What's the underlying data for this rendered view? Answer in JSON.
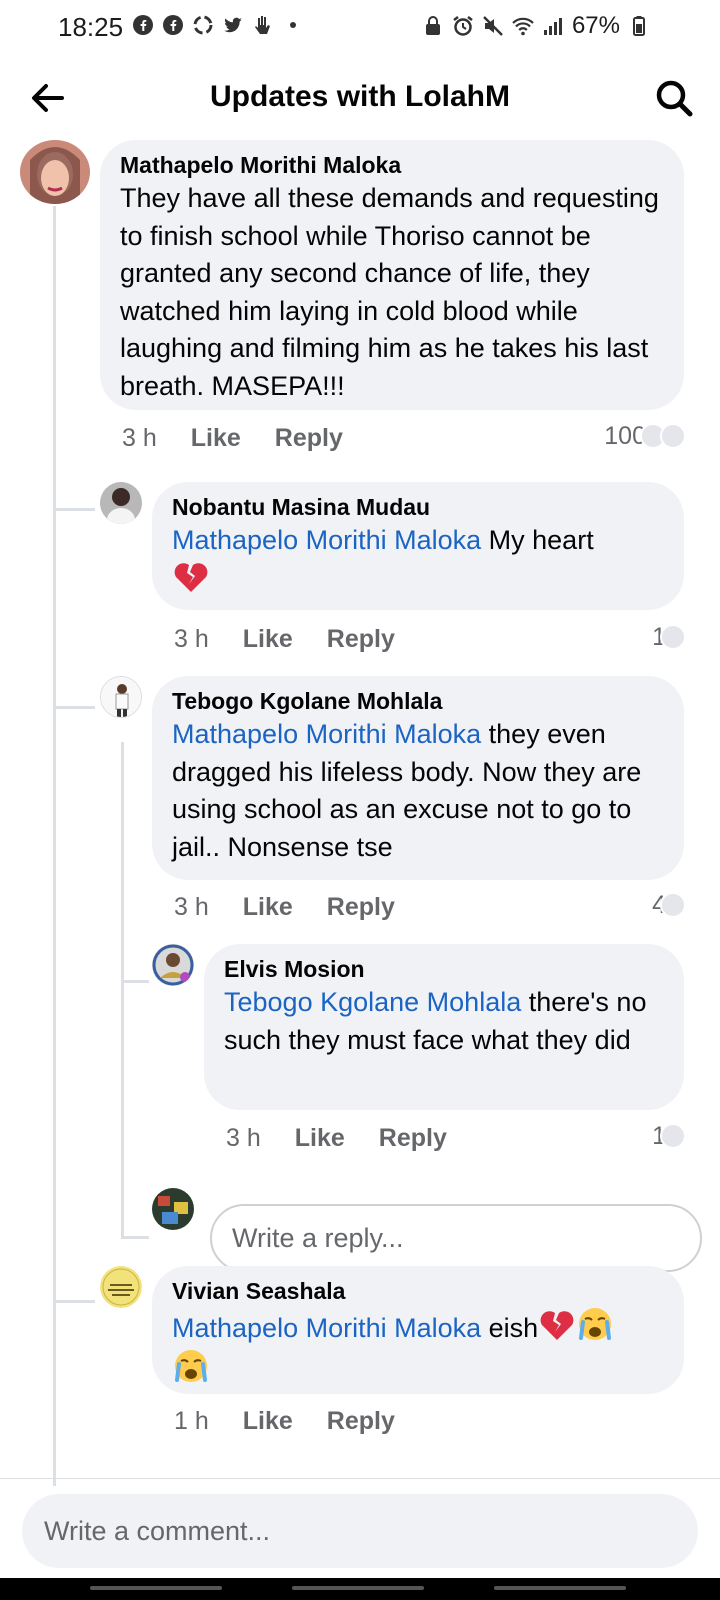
{
  "status_bar": {
    "time": "18:25",
    "battery": "67%",
    "left_icons": [
      "facebook-icon",
      "facebook-icon",
      "recycle-icon",
      "twitter-icon",
      "hand-icon"
    ],
    "right_icons": [
      "lock-icon",
      "alarm-icon",
      "mute-icon",
      "wifi-icon",
      "signal-icon",
      "battery-icon"
    ]
  },
  "header": {
    "title": "Updates with LolahM"
  },
  "comments": [
    {
      "author": "Mathapelo Morithi Maloka",
      "mention": "",
      "text": "They have all these demands and requesting to finish school while Thoriso cannot be granted any second chance of life, they watched him laying in cold blood while laughing and filming him as he takes his last breath. MASEPA!!!",
      "time": "3 h",
      "like": "Like",
      "reply": "Reply",
      "reactions": "100"
    },
    {
      "author": "Nobantu Masina Mudau",
      "mention": "Mathapelo Morithi Maloka",
      "text": " My heart",
      "emoji": "broken-heart",
      "time": "3 h",
      "like": "Like",
      "reply": "Reply",
      "reactions": "1"
    },
    {
      "author": "Tebogo Kgolane Mohlala",
      "mention": "Mathapelo Morithi Maloka",
      "text": " they even dragged his lifeless body. Now they are using school as an excuse not to go to jail.. Nonsense tse",
      "time": "3 h",
      "like": "Like",
      "reply": "Reply",
      "reactions": "4"
    },
    {
      "author": "Elvis Mosion",
      "mention": "Tebogo Kgolane Mohlala",
      "text": " there's no such they must face what they did",
      "time": "3 h",
      "like": "Like",
      "reply": "Reply",
      "reactions": "1"
    },
    {
      "author": "Vivian Seashala",
      "mention": "Mathapelo Morithi Maloka",
      "text": " eish",
      "time": "1 h",
      "like": "Like",
      "reply": "Reply"
    }
  ],
  "reply_box": {
    "placeholder": "Write a reply..."
  },
  "comment_box": {
    "placeholder": "Write a comment..."
  },
  "colors": {
    "bubble": "#f0f2f5",
    "mention": "#1b64c3",
    "meta": "#65676b"
  }
}
